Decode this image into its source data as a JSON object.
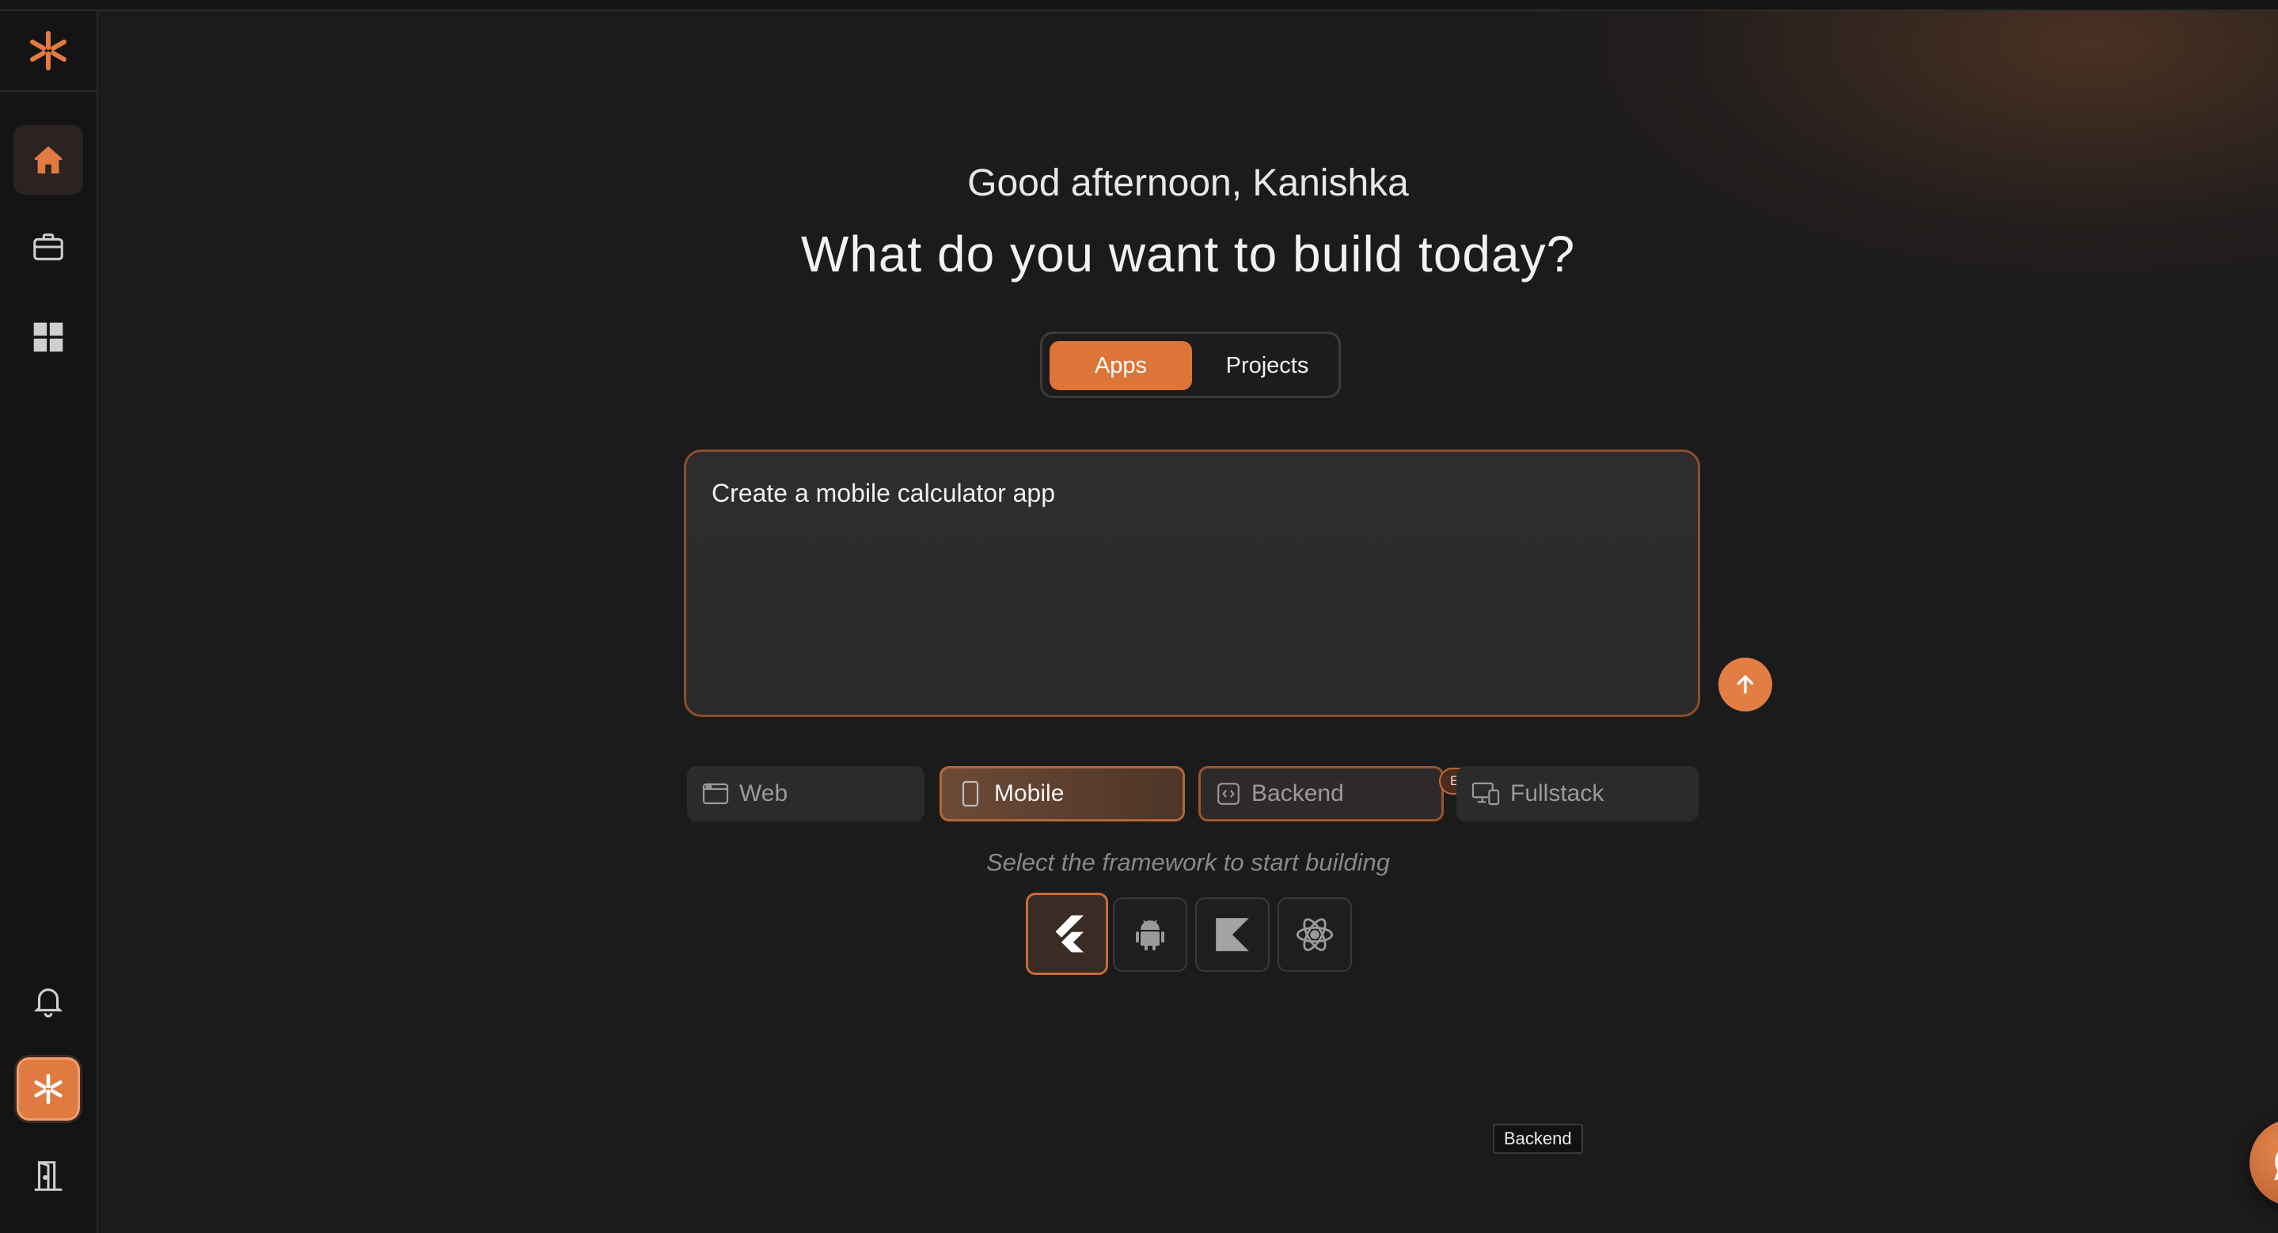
{
  "greeting": "Good afternoon, Kanishka",
  "headline": "What do you want to build today?",
  "mode_toggle": {
    "apps": "Apps",
    "projects": "Projects",
    "selected": "Apps"
  },
  "prompt": {
    "value": "Create a mobile calculator app"
  },
  "app_types": [
    {
      "label": "Web",
      "icon": "browser-window-icon"
    },
    {
      "label": "Mobile",
      "icon": "phone-icon",
      "selected": true
    },
    {
      "label": "Backend",
      "icon": "code-box-icon",
      "badge": "Experimental"
    },
    {
      "label": "Fullstack",
      "icon": "devices-icon"
    }
  ],
  "framework_hint": "Select the framework to start building",
  "frameworks": [
    "flutter-icon",
    "android-icon",
    "kotlin-icon",
    "react-native-icon"
  ],
  "tooltip": "Backend",
  "colors": {
    "accent": "#dd7438",
    "background": "#1c1b1c",
    "sidebar": "#151414"
  }
}
